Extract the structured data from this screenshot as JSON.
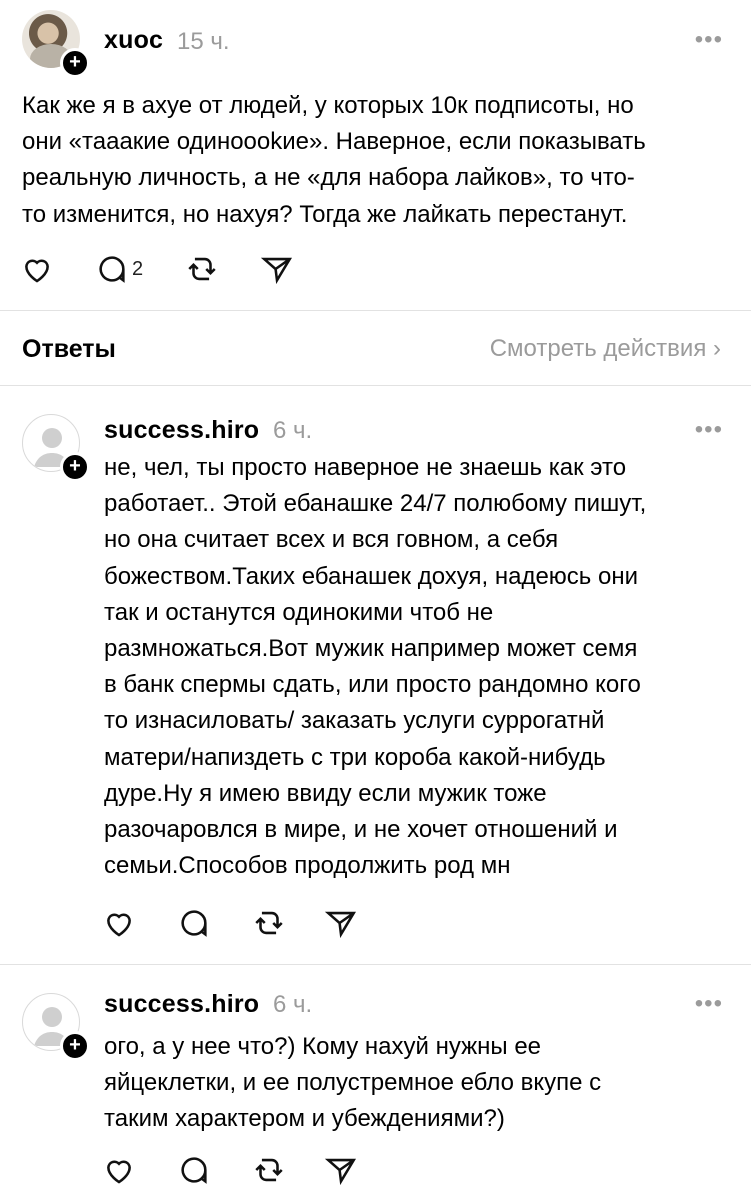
{
  "main_post": {
    "username": "xuoc",
    "time": "15 ч.",
    "more": "•••",
    "text": "Как же я в ахуе от людей, у которых 10к подписоты, но\nони «тааакие одиноookие». Наверное, если показывать\nреальную личность, а не «для набора лайков», то что-\nто изменится, но нахуя? Тогда же лайкать перестанут.",
    "reply_count": "2"
  },
  "answers_header": {
    "title": "Ответы",
    "view_actions": "Смотреть действия ›"
  },
  "replies": [
    {
      "username": "success.hiro",
      "time": "6 ч.",
      "more": "•••",
      "text": "не, чел, ты просто наверное не знаешь как это\nработает.. Этой ебанашке 24/7 полюбому пишут,\nно она считает всех и вся говном, а себя\nбожеством.Таких ебанашек дохуя, надеюсь они\nтак и останутся одинокими чтоб не\nразмножаться.Вот мужик например может семя\nв банк спермы сдать, или просто рандомно кого\nто изнасиловать/ заказать услуги суррогатнй\nматери/напиздеть с три короба какой-нибудь\nдуре.Ну я имею ввиду если мужик тоже\nразочаровлся в мире, и не хочет отношений и\nсемьи.Способов продолжить род мн"
    },
    {
      "username": "success.hiro",
      "time": "6 ч.",
      "more": "•••",
      "text": "ого, а у нее что?) Кому нахуй нужны ее\nяйцеклетки, и ее полустремное ебло вкупе с\nтаким характером и убеждениями?)"
    }
  ]
}
